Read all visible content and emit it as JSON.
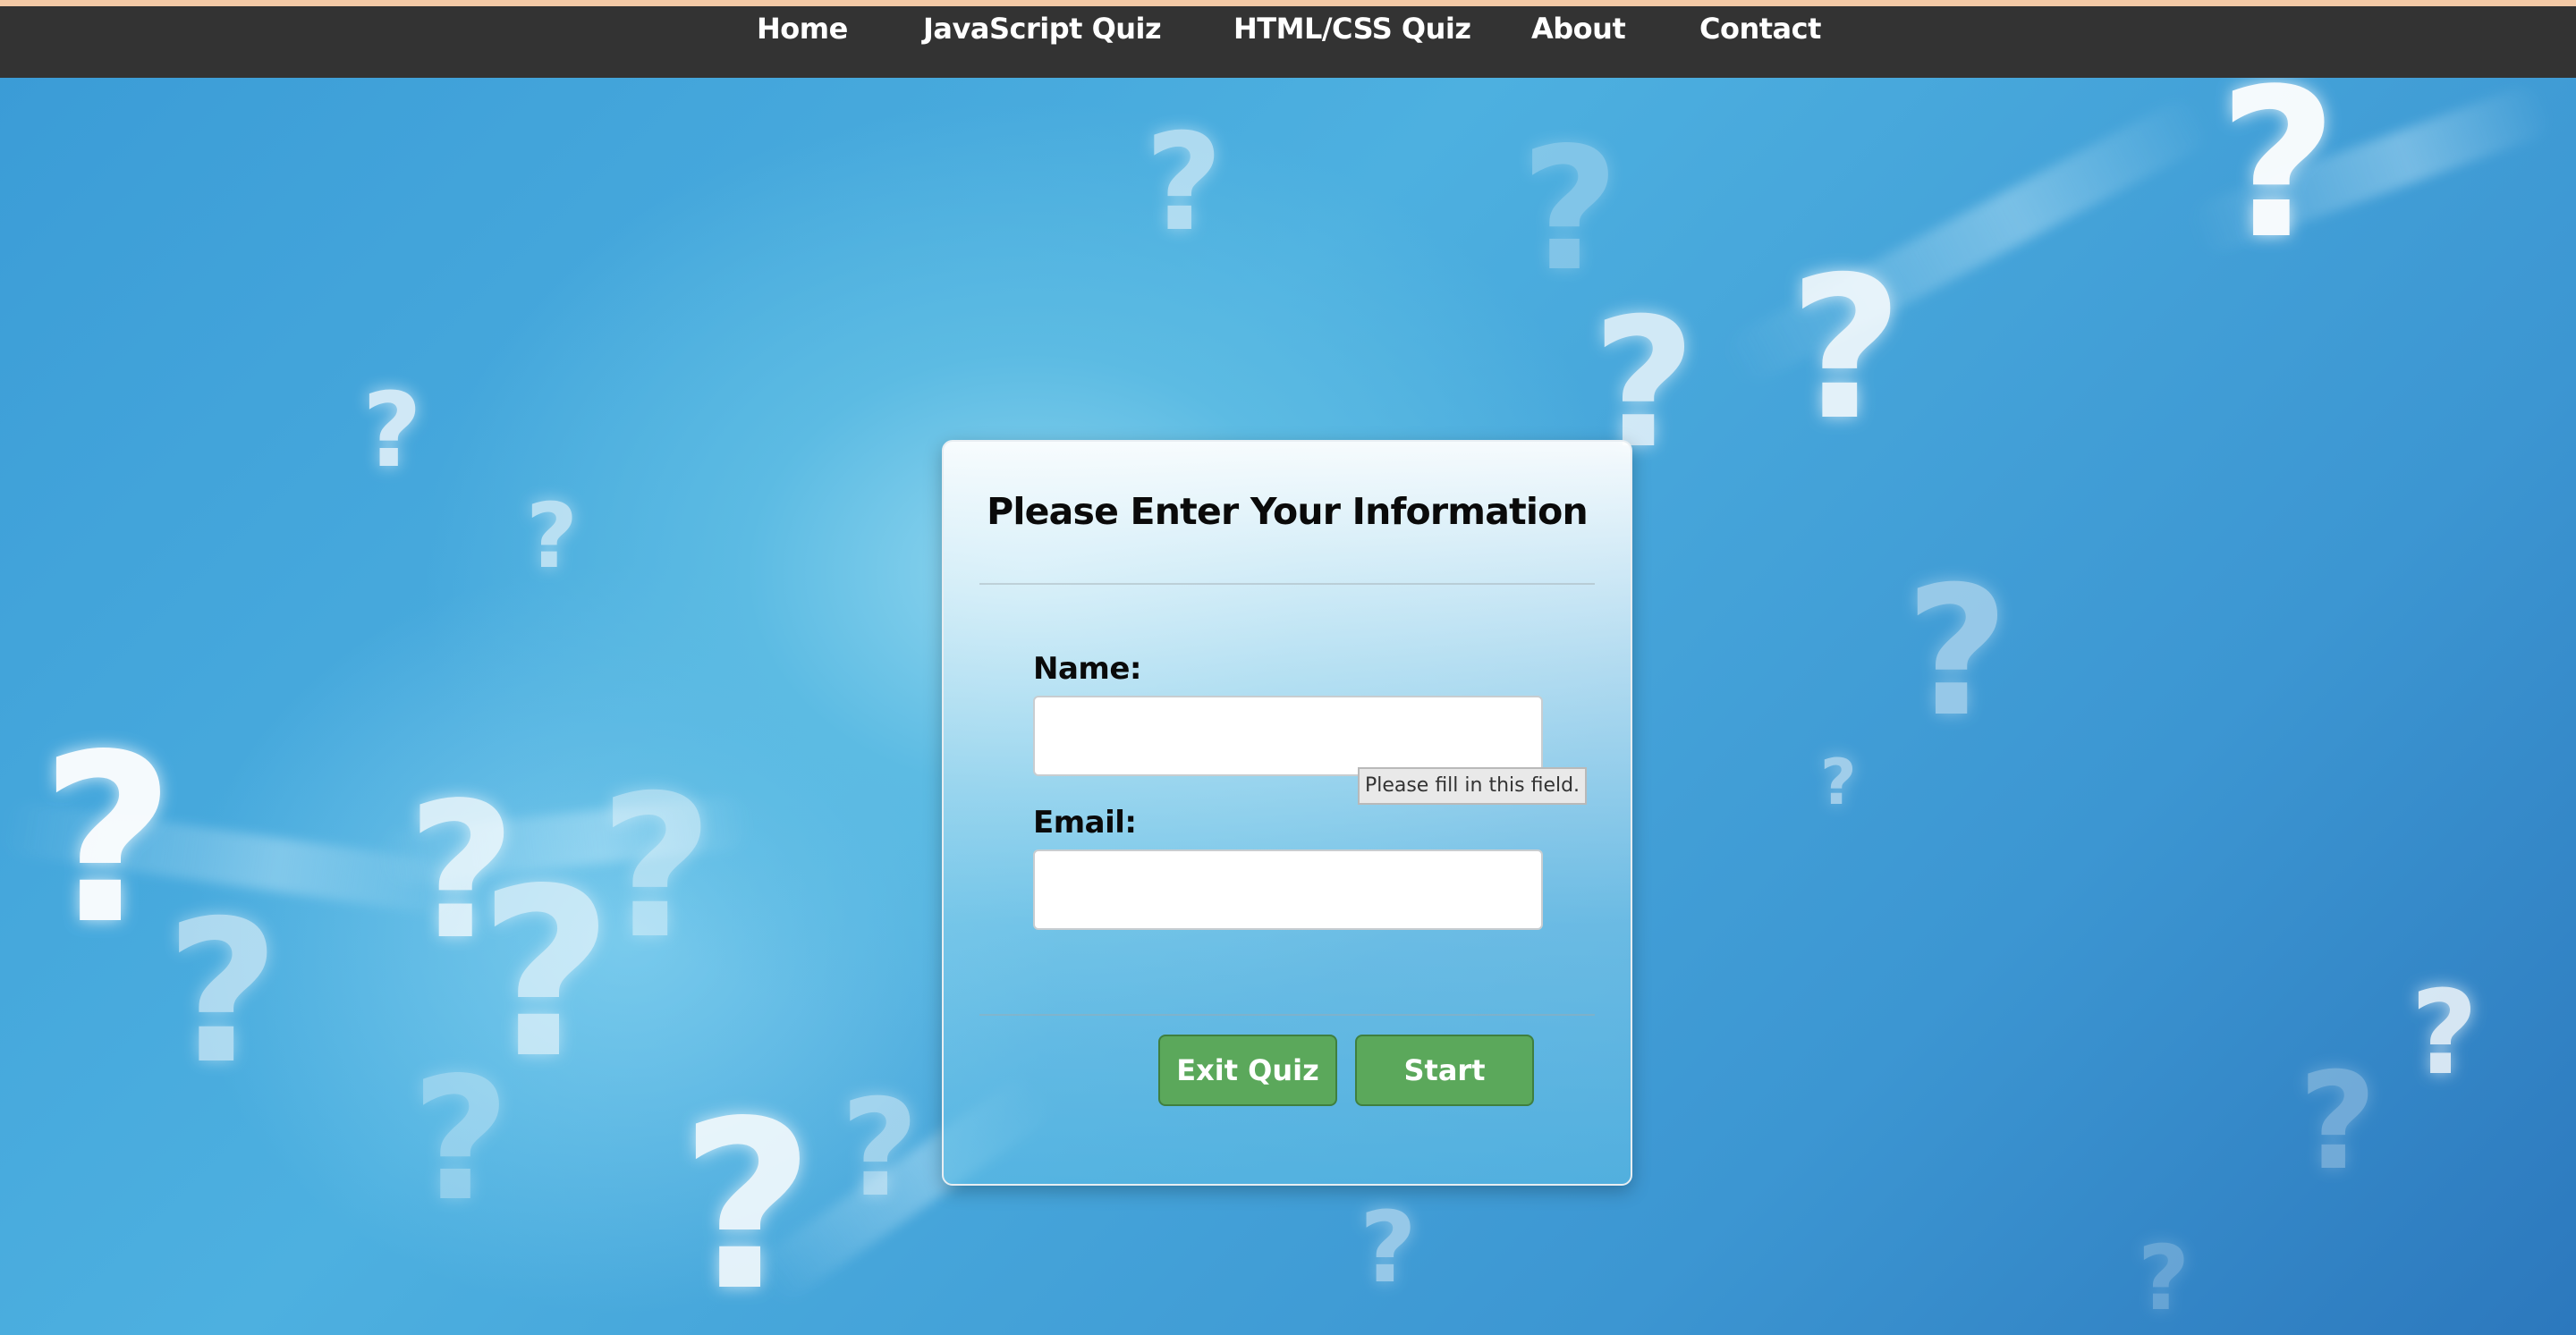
{
  "nav": {
    "items": [
      {
        "label": "Home"
      },
      {
        "label": "JavaScript Quiz"
      },
      {
        "label": "HTML/CSS Quiz"
      },
      {
        "label": "About"
      },
      {
        "label": "Contact"
      }
    ]
  },
  "background": {
    "glyph": "?"
  },
  "form": {
    "title": "Please Enter Your Information",
    "name_label": "Name:",
    "name_value": "",
    "email_label": "Email:",
    "email_value": "",
    "validation_tooltip": "Please fill in this field.",
    "exit_label": "Exit Quiz",
    "start_label": "Start"
  },
  "colors": {
    "navbar": "#333333",
    "top_strip": "#f3c9a6",
    "button": "#5ba85b",
    "background": "#3a9bd6"
  }
}
